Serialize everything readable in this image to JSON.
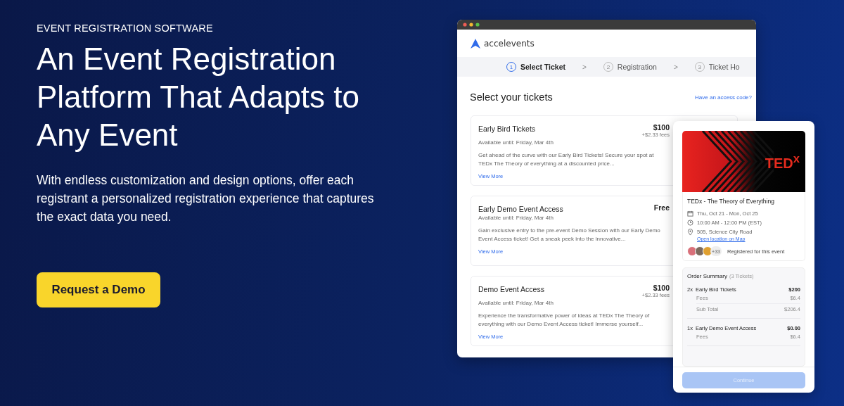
{
  "hero": {
    "eyebrow": "EVENT REGISTRATION SOFTWARE",
    "headline": "An Event Registration Platform That Adapts to Any Event",
    "description": "With endless customization and design options, offer each registrant a personalized registration experience that captures the exact data you need.",
    "cta": "Request a Demo"
  },
  "app_window": {
    "logo_text": "accelevents",
    "steps": [
      {
        "number": "1",
        "label": "Select Ticket",
        "selected": true
      },
      {
        "number": "2",
        "label": "Registration",
        "selected": false
      },
      {
        "number": "3",
        "label": "Ticket Ho",
        "selected": false
      }
    ],
    "step_separator": ">",
    "heading": "Select your tickets",
    "access_code_link": "Have an access code?",
    "tickets": [
      {
        "name": "Early Bird Tickets",
        "price": "$100",
        "fees": "+$2.33 fees",
        "availability": "Available until: Friday, Mar 4th",
        "description": "Get ahead of the curve with our Early Bird Tickets! Secure your spot at TEDx The Theory of everything at a discounted price...",
        "link": "View More"
      },
      {
        "name": "Early Demo Event Access",
        "price": "Free",
        "availability": "Available until: Friday, Mar 4th",
        "description": "Gain exclusive entry to the pre-event Demo Session with our Early Demo Event Access ticket! Get a sneak peek into the innovative...",
        "link": "View More"
      },
      {
        "name": "Demo Event Access",
        "price": "$100",
        "fees": "+$2.33 fees",
        "availability": "Available until: Friday, Mar 4th",
        "description": "Experience the transformative power of ideas at TEDx The Theory of everything with our Demo Event Access ticket! Immerse yourself...",
        "link": "View More"
      }
    ]
  },
  "event_card": {
    "banner_text": "TED$^{x}$",
    "title": "TEDx - The Theory of Everything",
    "date": "Thu, Oct 21 - Mon, Oct 25",
    "time": "10:00 AM - 12:00 PM (EST)",
    "address": "505, Science City Road",
    "map_link": "Open location on Map",
    "attendee_count": "+33",
    "attendee_text": "Registered for this event",
    "order_summary": {
      "title": "Order Summary",
      "ticket_count": "(3 Tickets)",
      "items": [
        {
          "qty": "2x",
          "name": "Early Bird Tickets",
          "price": "$200",
          "lines": [
            {
              "label": "Fees",
              "value": "$6.4"
            },
            {
              "label": "Sub Total",
              "value": "$206.4"
            }
          ]
        },
        {
          "qty": "1x",
          "name": "Early Demo Event Access",
          "price": "$0.00",
          "lines": [
            {
              "label": "Fees",
              "value": "$6.4"
            }
          ]
        }
      ]
    },
    "continue_button": {
      "label": "Continue",
      "disabled": true
    }
  }
}
